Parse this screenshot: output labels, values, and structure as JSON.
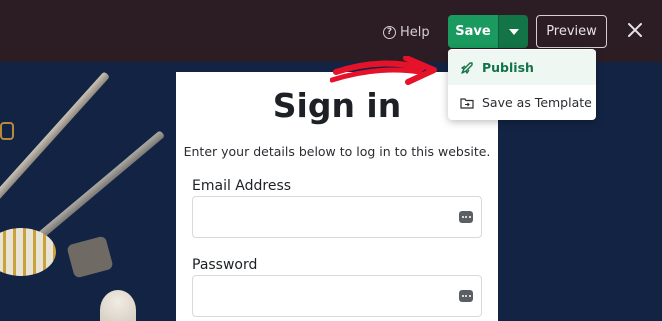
{
  "topbar": {
    "help_label": "Help",
    "save_label": "Save",
    "preview_label": "Preview"
  },
  "dropdown": {
    "items": [
      {
        "label": "Publish",
        "icon": "rocket-icon",
        "active": true
      },
      {
        "label": "Save as Template",
        "icon": "folder-icon",
        "active": false
      }
    ]
  },
  "signin": {
    "title": "Sign in",
    "subtitle": "Enter your details below to log in to this website.",
    "email_label": "Email Address",
    "email_value": "",
    "password_label": "Password",
    "password_value": ""
  },
  "colors": {
    "topbar_bg": "#2c1d25",
    "save_green": "#1a9a5e",
    "save_dark_green": "#137447",
    "arrow_red": "#e5122a",
    "canvas_bg": "#132343"
  }
}
